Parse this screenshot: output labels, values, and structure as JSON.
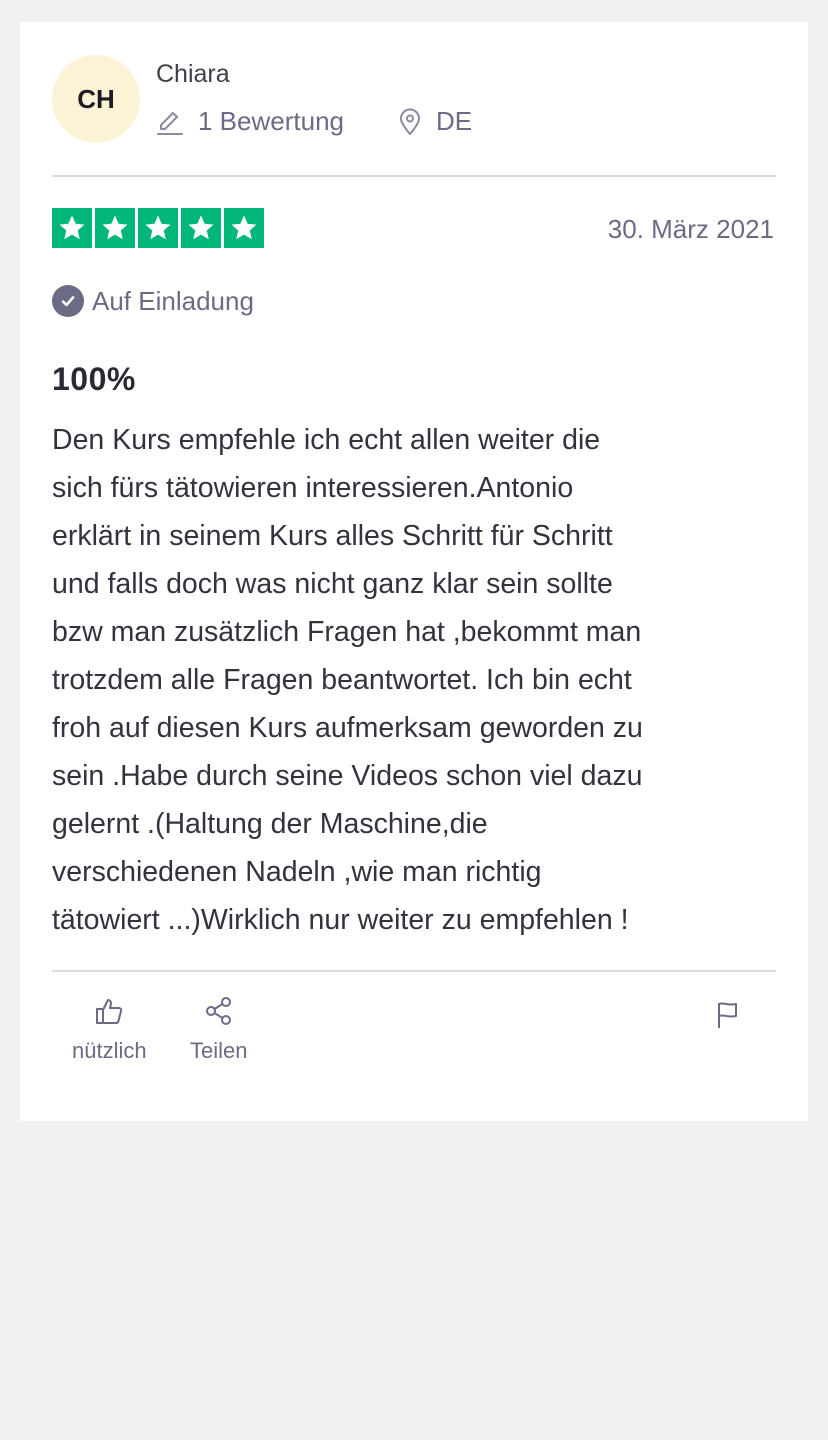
{
  "reviewer": {
    "initials": "CH",
    "name": "Chiara",
    "review_count": "1 Bewertung",
    "country": "DE"
  },
  "review": {
    "rating": 5,
    "date": "30. März 2021",
    "source": "Auf Einladung",
    "title": "100%",
    "text": "Den Kurs empfehle ich echt allen weiter die\nsich fürs tätowieren interessieren.Antonio\nerklärt in seinem Kurs alles Schritt für Schritt\nund falls doch was nicht ganz klar sein sollte\nbzw man zusätzlich Fragen hat ,bekommt man\ntrotzdem alle Fragen beantwortet. Ich bin echt\nfroh auf diesen Kurs aufmerksam geworden zu\nsein .Habe durch seine Videos schon viel dazu\ngelernt .(Haltung der Maschine,die\nverschiedenen Nadeln ,wie man richtig\ntätowiert ...)Wirklich nur weiter zu empfehlen !"
  },
  "actions": {
    "useful_label": "nützlich",
    "share_label": "Teilen"
  },
  "colors": {
    "star_green": "#00b67a",
    "avatar_bg": "#fcf3d6",
    "muted_text": "#6b6b85"
  },
  "icons": {
    "review_count": "pencil-icon",
    "country": "location-pin-icon",
    "source": "check-badge-icon",
    "useful": "thumbs-up-icon",
    "share": "share-icon",
    "report": "flag-icon"
  }
}
